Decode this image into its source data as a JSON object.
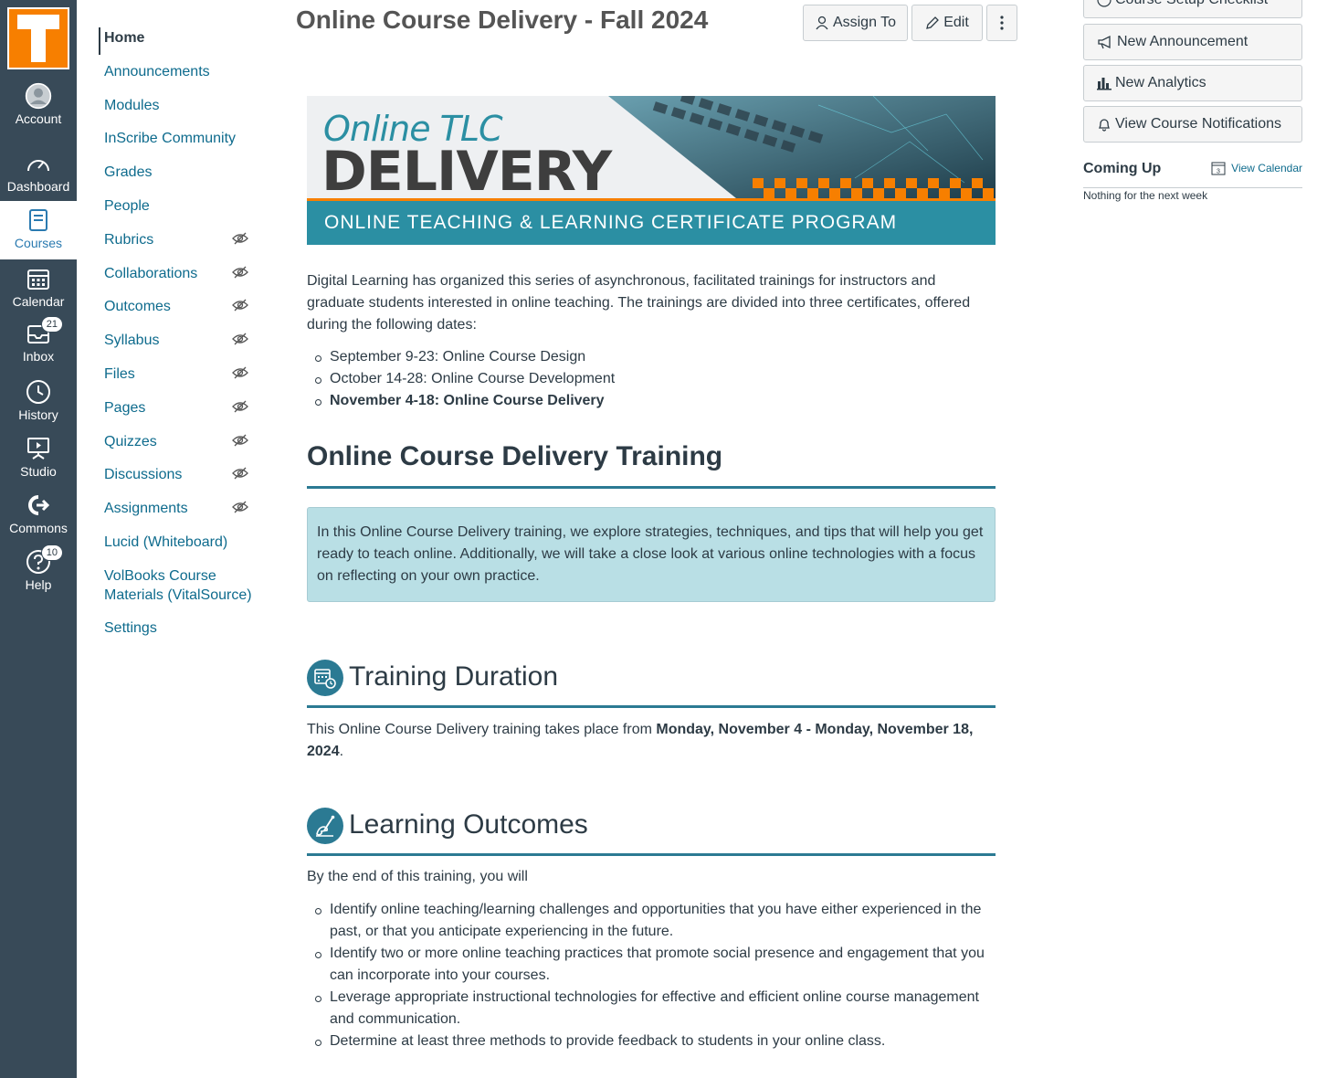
{
  "global_nav": {
    "account": "Account",
    "dashboard": "Dashboard",
    "courses": "Courses",
    "calendar": "Calendar",
    "inbox": "Inbox",
    "inbox_badge": "21",
    "history": "History",
    "studio": "Studio",
    "commons": "Commons",
    "help": "Help",
    "help_badge": "10"
  },
  "course_nav": {
    "items": [
      "Home",
      "Announcements",
      "Modules",
      "InScribe Community",
      "Grades",
      "People",
      "Rubrics",
      "Collaborations",
      "Outcomes",
      "Syllabus",
      "Files",
      "Pages",
      "Quizzes",
      "Discussions",
      "Assignments",
      "Lucid (Whiteboard)",
      "VolBooks Course Materials (VitalSource)",
      "Settings"
    ]
  },
  "header": {
    "title": "Online Course Delivery - Fall 2024",
    "assign_to": "Assign To",
    "edit": "Edit"
  },
  "banner": {
    "tlc": "Online TLC",
    "delivery": "DELIVERY",
    "program": "ONLINE TEACHING & LEARNING CERTIFICATE PROGRAM"
  },
  "content": {
    "intro": "Digital Learning has organized this series of asynchronous, facilitated trainings for instructors and graduate students interested in online teaching. The trainings are divided into three certificates, offered during the following dates:",
    "dates": [
      "September 9-23: Online Course Design",
      "October 14-28: Online Course Development",
      "November 4-18: Online Course Delivery"
    ],
    "training_heading": "Online Course Delivery Training",
    "callout": "In this Online Course Delivery training, we explore strategies, techniques, and tips that will help you get ready to teach online. Additionally, we will take a close look at various online technologies with a focus on reflecting on your own practice.",
    "duration_heading": "Training Duration",
    "duration_prefix": "This Online Course Delivery training takes place from ",
    "duration_bold": "Monday, November 4 - Monday, November 18, 2024",
    "duration_suffix": ".",
    "outcomes_heading": "Learning Outcomes",
    "outcomes_intro": "By the end of this training, you will",
    "outcomes": [
      "Identify online teaching/learning challenges and opportunities that you have either experienced in the past, or that you anticipate experiencing in the future.",
      "Identify two or more online teaching practices that promote social presence and engagement that you can incorporate into your courses.",
      "Leverage appropriate instructional technologies for effective and efficient online course management and communication.",
      "Determine at least three methods to provide feedback to students in your online class."
    ]
  },
  "sidebar": {
    "checklist": "Course Setup Checklist",
    "announcement": "New Announcement",
    "analytics": "New Analytics",
    "notifications": "View Course Notifications",
    "coming_up": "Coming Up",
    "view_calendar": "View Calendar",
    "calendar_icon_day": "3",
    "nothing": "Nothing for the next week"
  },
  "colors": {
    "nav_bg": "#384a58",
    "brand_orange": "#f77f00",
    "link": "#0e6b8d",
    "teal": "#2b8fa3"
  }
}
